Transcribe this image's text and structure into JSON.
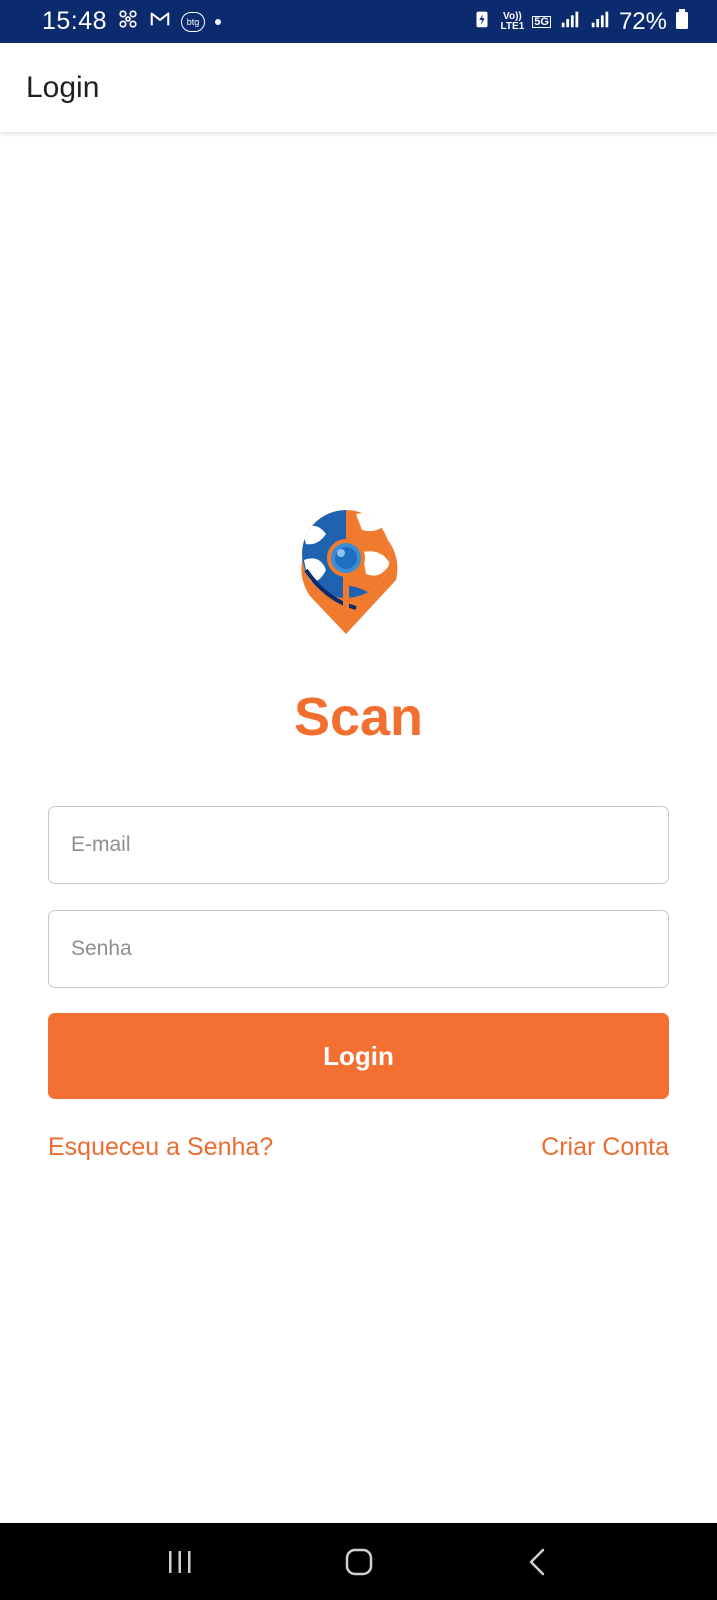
{
  "status_bar": {
    "time": "15:48",
    "badge_text": "btg",
    "volte_top": "Vo))",
    "volte_bottom": "LTE1",
    "network": "5G",
    "battery": "72%",
    "icons": [
      "fan-icon",
      "gmail-icon",
      "btg-icon",
      "notification-dot-icon",
      "battery-saver-icon",
      "volte-icon",
      "5g-icon",
      "signal-icon",
      "signal-icon",
      "battery-icon"
    ]
  },
  "app_bar": {
    "title": "Login"
  },
  "logo": {
    "title": "Scan",
    "icon": "globe-pin-search-icon"
  },
  "form": {
    "email_placeholder": "E-mail",
    "password_placeholder": "Senha",
    "login_label": "Login"
  },
  "links": {
    "forgot_password": "Esqueceu a Senha?",
    "create_account": "Criar Conta"
  },
  "nav_bar": {
    "icons": [
      "recent-apps-icon",
      "home-icon",
      "back-icon"
    ]
  },
  "colors": {
    "status_bar": "#0c2a6e",
    "accent": "#f46f32",
    "link": "#ee6c2f",
    "logo_blue": "#1f63b0"
  }
}
